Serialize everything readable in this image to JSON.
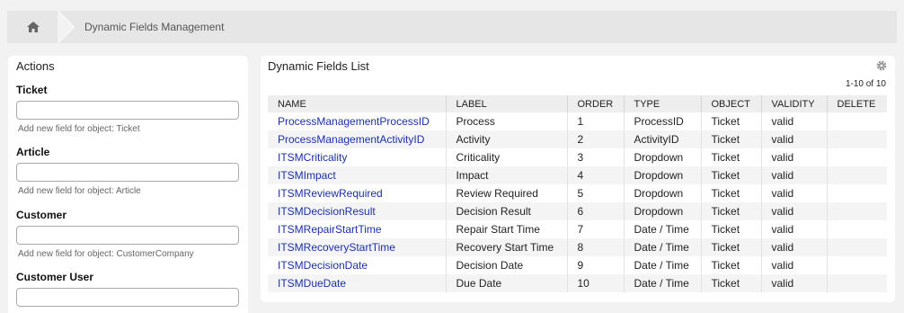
{
  "breadcrumb": {
    "home_icon": "home-icon",
    "current": "Dynamic Fields Management"
  },
  "sidebar": {
    "title": "Actions",
    "objects": [
      {
        "label": "Ticket",
        "hint": "Add new field for object: Ticket"
      },
      {
        "label": "Article",
        "hint": "Add new field for object: Article"
      },
      {
        "label": "Customer",
        "hint": "Add new field for object: CustomerCompany"
      },
      {
        "label": "Customer User",
        "hint": ""
      }
    ]
  },
  "panel": {
    "title": "Dynamic Fields List",
    "settings_icon": "gear-icon",
    "pager": "1-10 of 10",
    "columns": [
      "NAME",
      "LABEL",
      "ORDER",
      "TYPE",
      "OBJECT",
      "VALIDITY",
      "DELETE"
    ],
    "rows": [
      {
        "name": "ProcessManagementProcessID",
        "label": "Process",
        "order": "1",
        "type": "ProcessID",
        "object": "Ticket",
        "validity": "valid"
      },
      {
        "name": "ProcessManagementActivityID",
        "label": "Activity",
        "order": "2",
        "type": "ActivityID",
        "object": "Ticket",
        "validity": "valid"
      },
      {
        "name": "ITSMCriticality",
        "label": "Criticality",
        "order": "3",
        "type": "Dropdown",
        "object": "Ticket",
        "validity": "valid"
      },
      {
        "name": "ITSMImpact",
        "label": "Impact",
        "order": "4",
        "type": "Dropdown",
        "object": "Ticket",
        "validity": "valid"
      },
      {
        "name": "ITSMReviewRequired",
        "label": "Review Required",
        "order": "5",
        "type": "Dropdown",
        "object": "Ticket",
        "validity": "valid"
      },
      {
        "name": "ITSMDecisionResult",
        "label": "Decision Result",
        "order": "6",
        "type": "Dropdown",
        "object": "Ticket",
        "validity": "valid"
      },
      {
        "name": "ITSMRepairStartTime",
        "label": "Repair Start Time",
        "order": "7",
        "type": "Date / Time",
        "object": "Ticket",
        "validity": "valid"
      },
      {
        "name": "ITSMRecoveryStartTime",
        "label": "Recovery Start Time",
        "order": "8",
        "type": "Date / Time",
        "object": "Ticket",
        "validity": "valid"
      },
      {
        "name": "ITSMDecisionDate",
        "label": "Decision Date",
        "order": "9",
        "type": "Date / Time",
        "object": "Ticket",
        "validity": "valid"
      },
      {
        "name": "ITSMDueDate",
        "label": "Due Date",
        "order": "10",
        "type": "Date / Time",
        "object": "Ticket",
        "validity": "valid"
      }
    ]
  }
}
